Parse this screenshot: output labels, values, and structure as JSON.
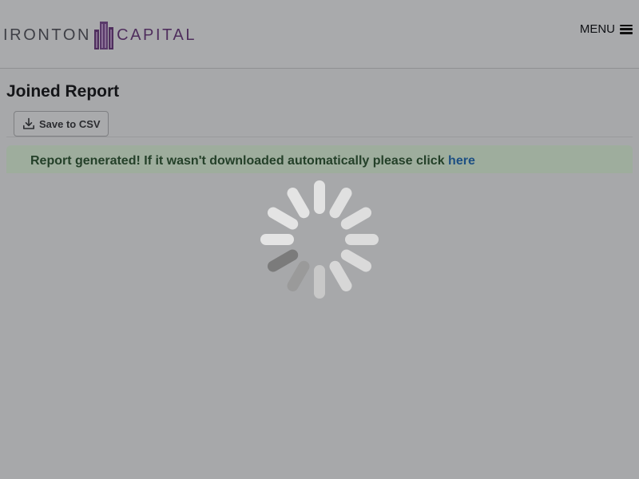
{
  "header": {
    "logo_part1": "IRONTON",
    "logo_part2": "CAPITAL",
    "menu_label": "MENU"
  },
  "main": {
    "title": "Joined Report",
    "save_csv_label": "Save to CSV",
    "alert_text": "Report generated! If it wasn't downloaded automatically please click ",
    "alert_link": "here"
  },
  "icons": {
    "menu": "hamburger-icon",
    "save": "download-icon",
    "loading": "loading-spinner"
  },
  "colors": {
    "overlay": "#a7a8aa",
    "alert_bg": "#9ead9d",
    "alert_text": "#244029",
    "link": "#1d4f83",
    "logo_dark": "#3e3f46",
    "logo_purple": "#4f2e5d"
  }
}
